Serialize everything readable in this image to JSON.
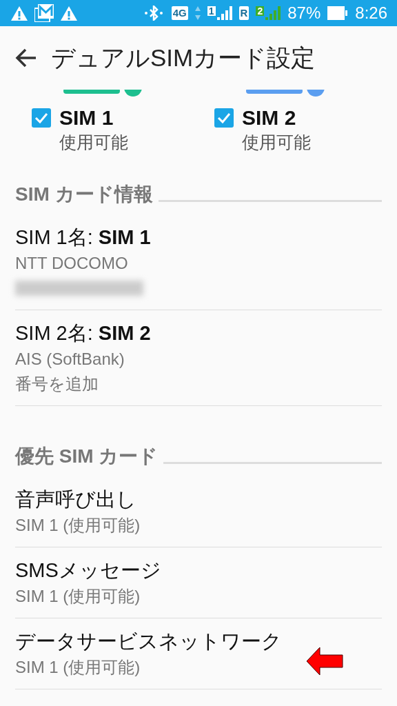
{
  "status_bar": {
    "sim1_signal_label": "1",
    "network_badge": "4G",
    "roaming_badge": "R",
    "sim2_signal_label": "2",
    "battery": "87%",
    "time": "8:26"
  },
  "header": {
    "title": "デュアルSIMカード設定"
  },
  "sim_slots": [
    {
      "label": "SIM 1",
      "status": "使用可能",
      "checked": true,
      "color": "#1dbf8f"
    },
    {
      "label": "SIM 2",
      "status": "使用可能",
      "checked": true,
      "color": "#5b9ef0"
    }
  ],
  "sections": [
    {
      "title": "SIM カード情報",
      "items": [
        {
          "title": "SIM 1名: **SIM 1**",
          "lines": [
            {
              "kind": "text",
              "text": "NTT DOCOMO"
            },
            {
              "kind": "redacted"
            }
          ]
        },
        {
          "title": "SIM 2名: **SIM 2**",
          "lines": [
            {
              "kind": "text",
              "text": "AIS (SoftBank)"
            },
            {
              "kind": "text",
              "text": "番号を追加"
            }
          ]
        }
      ]
    },
    {
      "title": "優先 SIM カード",
      "items": [
        {
          "title": "音声呼び出し",
          "lines": [
            {
              "kind": "text",
              "text": "SIM 1 (使用可能)"
            }
          ]
        },
        {
          "title": "SMSメッセージ",
          "lines": [
            {
              "kind": "text",
              "text": "SIM 1 (使用可能)"
            }
          ]
        },
        {
          "title": "データサービスネットワーク",
          "lines": [
            {
              "kind": "text",
              "text": "SIM 1 (使用可能)"
            }
          ],
          "pointed": true
        }
      ]
    }
  ]
}
